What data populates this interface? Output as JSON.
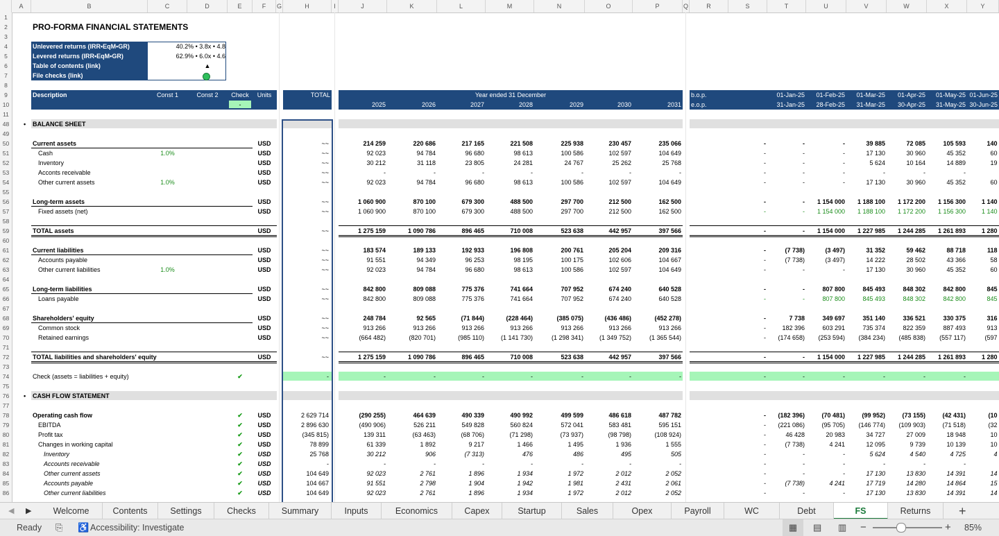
{
  "columns": [
    "A",
    "B",
    "C",
    "D",
    "E",
    "F",
    "G",
    "H",
    "I",
    "J",
    "K",
    "L",
    "M",
    "N",
    "O",
    "P",
    "Q",
    "R",
    "S",
    "T",
    "U",
    "V",
    "W",
    "X",
    "Y"
  ],
  "rows": [
    "1",
    "2",
    "3",
    "4",
    "5",
    "6",
    "7",
    "8",
    "9",
    "10",
    "11",
    "48",
    "49",
    "50",
    "51",
    "52",
    "53",
    "54",
    "55",
    "56",
    "57",
    "58",
    "59",
    "60",
    "61",
    "62",
    "63",
    "64",
    "65",
    "66",
    "67",
    "68",
    "69",
    "70",
    "71",
    "72",
    "73",
    "74",
    "75",
    "76",
    "77",
    "78",
    "79",
    "80",
    "81",
    "82",
    "83",
    "84",
    "85",
    "86"
  ],
  "title": "PRO-FORMA FINANCIAL STATEMENTS",
  "summary": {
    "unlev_label": "Unlevered returns (IRR•EqM•GR)",
    "unlev_value": "40.2% • 3.8x • 4.8",
    "lev_label": "Levered returns (IRR•EqM•GR)",
    "lev_value": "62.9% • 6.0x • 4.6",
    "toc_label": "Table of contents (link)",
    "toc_icon": "▲",
    "checks_label": "File checks (link)"
  },
  "header": {
    "description": "Description",
    "const1": "Const 1",
    "const2": "Const 2",
    "check": "Check",
    "check_value": "-",
    "units": "Units",
    "total": "TOTAL",
    "year_ended": "Year ended 31 December",
    "years": [
      "2025",
      "2026",
      "2027",
      "2028",
      "2029",
      "2030",
      "2031"
    ],
    "bop": "b.o.p.",
    "eop": "e.o.p.",
    "month_starts": [
      "01-Jan-25",
      "01-Feb-25",
      "01-Mar-25",
      "01-Apr-25",
      "01-May-25",
      "01-Jun-25",
      "01-Jul-2"
    ],
    "month_ends": [
      "31-Jan-25",
      "28-Feb-25",
      "31-Mar-25",
      "30-Apr-25",
      "31-May-25",
      "30-Jun-25",
      "31-Jul-2"
    ]
  },
  "sections": {
    "balance": "BALANCE SHEET",
    "cashflow": "CASH FLOW STATEMENT",
    "bullet": "•"
  },
  "lines": [
    {
      "row": 50,
      "label": "Current assets",
      "bold": true,
      "units": "USD",
      "total": "~~",
      "years": [
        "214 259",
        "220 686",
        "217 165",
        "221 508",
        "225 938",
        "230 457",
        "235 066"
      ],
      "months": [
        "-",
        "-",
        "-",
        "39 885",
        "72 085",
        "105 593",
        "140 01"
      ]
    },
    {
      "row": 51,
      "label": "Cash",
      "indent": 1,
      "const1": "1.0%",
      "units": "USD",
      "total": "~~",
      "years": [
        "92 023",
        "94 784",
        "96 680",
        "98 613",
        "100 586",
        "102 597",
        "104 649"
      ],
      "months": [
        "-",
        "-",
        "-",
        "17 130",
        "30 960",
        "45 352",
        "60 13"
      ]
    },
    {
      "row": 52,
      "label": "Inventory",
      "indent": 1,
      "units": "USD",
      "total": "~~",
      "years": [
        "30 212",
        "31 118",
        "23 805",
        "24 281",
        "24 767",
        "25 262",
        "25 768"
      ],
      "months": [
        "-",
        "-",
        "-",
        "5 624",
        "10 164",
        "14 889",
        "19 74"
      ]
    },
    {
      "row": 53,
      "label": "Acconts receivable",
      "indent": 1,
      "units": "USD",
      "total": "~~",
      "years": [
        "-",
        "-",
        "-",
        "-",
        "-",
        "-",
        "-"
      ],
      "months": [
        "-",
        "-",
        "-",
        "-",
        "-",
        "-",
        "-"
      ]
    },
    {
      "row": 54,
      "label": "Other current assets",
      "indent": 1,
      "const1": "1.0%",
      "units": "USD",
      "total": "~~",
      "years": [
        "92 023",
        "94 784",
        "96 680",
        "98 613",
        "100 586",
        "102 597",
        "104 649"
      ],
      "months": [
        "-",
        "-",
        "-",
        "17 130",
        "30 960",
        "45 352",
        "60 13"
      ]
    },
    {
      "row": 56,
      "label": "Long-term assets",
      "bold": true,
      "units": "USD",
      "total": "~~",
      "years": [
        "1 060 900",
        "870 100",
        "679 300",
        "488 500",
        "297 700",
        "212 500",
        "162 500"
      ],
      "months": [
        "-",
        "-",
        "1 154 000",
        "1 188 100",
        "1 172 200",
        "1 156 300",
        "1 140 40"
      ]
    },
    {
      "row": 57,
      "label": "Fixed assets (net)",
      "indent": 1,
      "units": "USD",
      "total": "~~",
      "years": [
        "1 060 900",
        "870 100",
        "679 300",
        "488 500",
        "297 700",
        "212 500",
        "162 500"
      ],
      "months": [
        "-",
        "-",
        "1 154 000",
        "1 188 100",
        "1 172 200",
        "1 156 300",
        "1 140 40"
      ],
      "green_months": true
    },
    {
      "row": 59,
      "label": "TOTAL assets",
      "bold": true,
      "units": "USD",
      "total": "~~",
      "years": [
        "1 275 159",
        "1 090 786",
        "896 465",
        "710 008",
        "523 638",
        "442 957",
        "397 566"
      ],
      "months": [
        "-",
        "-",
        "1 154 000",
        "1 227 985",
        "1 244 285",
        "1 261 893",
        "1 280 41"
      ],
      "dbl": true
    },
    {
      "row": 61,
      "label": "Current liabilities",
      "bold": true,
      "units": "USD",
      "total": "~~",
      "years": [
        "183 574",
        "189 133",
        "192 933",
        "196 808",
        "200 761",
        "205 204",
        "209 316"
      ],
      "months": [
        "-",
        "(7 738)",
        "(3 497)",
        "31 352",
        "59 462",
        "88 718",
        "118 77"
      ]
    },
    {
      "row": 62,
      "label": "Accounts payable",
      "indent": 1,
      "units": "USD",
      "total": "~~",
      "years": [
        "91 551",
        "94 349",
        "96 253",
        "98 195",
        "100 175",
        "102 606",
        "104 667"
      ],
      "months": [
        "-",
        "(7 738)",
        "(3 497)",
        "14 222",
        "28 502",
        "43 366",
        "58 63"
      ]
    },
    {
      "row": 63,
      "label": "Other current liabilities",
      "indent": 1,
      "const1": "1.0%",
      "units": "USD",
      "total": "~~",
      "years": [
        "92 023",
        "94 784",
        "96 680",
        "98 613",
        "100 586",
        "102 597",
        "104 649"
      ],
      "months": [
        "-",
        "-",
        "-",
        "17 130",
        "30 960",
        "45 352",
        "60 13"
      ]
    },
    {
      "row": 65,
      "label": "Long-term liabilities",
      "bold": true,
      "units": "USD",
      "total": "~~",
      "years": [
        "842 800",
        "809 088",
        "775 376",
        "741 664",
        "707 952",
        "674 240",
        "640 528"
      ],
      "months": [
        "-",
        "-",
        "807 800",
        "845 493",
        "848 302",
        "842 800",
        "845 60"
      ]
    },
    {
      "row": 66,
      "label": "Loans payable",
      "indent": 1,
      "units": "USD",
      "total": "~~",
      "years": [
        "842 800",
        "809 088",
        "775 376",
        "741 664",
        "707 952",
        "674 240",
        "640 528"
      ],
      "months": [
        "-",
        "-",
        "807 800",
        "845 493",
        "848 302",
        "842 800",
        "845 60"
      ],
      "green_months": true
    },
    {
      "row": 68,
      "label": "Shareholders' equity",
      "bold": true,
      "units": "USD",
      "total": "~~",
      "years": [
        "248 784",
        "92 565",
        "(71 844)",
        "(228 464)",
        "(385 075)",
        "(436 486)",
        "(452 278)"
      ],
      "months": [
        "-",
        "7 738",
        "349 697",
        "351 140",
        "336 521",
        "330 375",
        "316 03"
      ]
    },
    {
      "row": 69,
      "label": "Common stock",
      "indent": 1,
      "units": "USD",
      "total": "~~",
      "years": [
        "913 266",
        "913 266",
        "913 266",
        "913 266",
        "913 266",
        "913 266",
        "913 266"
      ],
      "months": [
        "-",
        "182 396",
        "603 291",
        "735 374",
        "822 359",
        "887 493",
        "913 26"
      ]
    },
    {
      "row": 70,
      "label": "Retained earnings",
      "indent": 1,
      "units": "USD",
      "total": "~~",
      "years": [
        "(664 482)",
        "(820 701)",
        "(985 110)",
        "(1 141 730)",
        "(1 298 341)",
        "(1 349 752)",
        "(1 365 544)"
      ],
      "months": [
        "-",
        "(174 658)",
        "(253 594)",
        "(384 234)",
        "(485 838)",
        "(557 117)",
        "(597 23"
      ]
    },
    {
      "row": 72,
      "label": "TOTAL liabilities and shareholders' equity",
      "bold": true,
      "units": "USD",
      "total": "~~",
      "years": [
        "1 275 159",
        "1 090 786",
        "896 465",
        "710 008",
        "523 638",
        "442 957",
        "397 566"
      ],
      "months": [
        "-",
        "-",
        "1 154 000",
        "1 227 985",
        "1 244 285",
        "1 261 893",
        "1 280 41"
      ],
      "dbl": true
    },
    {
      "row": 74,
      "label": "Check (assets = liabilities + equity)",
      "check": true,
      "total": "-",
      "years": [
        "-",
        "-",
        "-",
        "-",
        "-",
        "-",
        "-"
      ],
      "months": [
        "-",
        "-",
        "-",
        "-",
        "-",
        "-",
        "-"
      ],
      "green_band": true
    },
    {
      "row": 78,
      "label": "Operating cash flow",
      "bold": true,
      "check": true,
      "units": "USD",
      "total": "2 629 714",
      "years": [
        "(290 255)",
        "464 639",
        "490 339",
        "490 992",
        "499 599",
        "486 618",
        "487 782"
      ],
      "months": [
        "-",
        "(182 396)",
        "(70 481)",
        "(99 952)",
        "(73 155)",
        "(42 431)",
        "(10 98"
      ]
    },
    {
      "row": 79,
      "label": "EBITDA",
      "indent": 1,
      "check": true,
      "units": "USD",
      "total": "2 896 630",
      "years": [
        "(490 906)",
        "526 211",
        "549 828",
        "560 824",
        "572 041",
        "583 481",
        "595 151"
      ],
      "months": [
        "-",
        "(221 086)",
        "(95 705)",
        "(146 774)",
        "(109 903)",
        "(71 518)",
        "(32 06"
      ]
    },
    {
      "row": 80,
      "label": "Profit tax",
      "indent": 1,
      "check": true,
      "units": "USD",
      "total": "(345 815)",
      "years": [
        "139 311",
        "(63 463)",
        "(68 706)",
        "(71 298)",
        "(73 937)",
        "(98 798)",
        "(108 924)"
      ],
      "months": [
        "-",
        "46 428",
        "20 983",
        "34 727",
        "27 009",
        "18 948",
        "10 66"
      ]
    },
    {
      "row": 81,
      "label": "Changes in working capital",
      "indent": 1,
      "check": true,
      "units": "USD",
      "total": "78 899",
      "years": [
        "61 339",
        "1 892",
        "9 217",
        "1 466",
        "1 495",
        "1 936",
        "1 555"
      ],
      "months": [
        "-",
        "(7 738)",
        "4 241",
        "12 095",
        "9 739",
        "10 139",
        "10 41"
      ]
    },
    {
      "row": 82,
      "label": "Inventory",
      "indent": 2,
      "italic": true,
      "check": true,
      "units": "USD",
      "total": "25 768",
      "years": [
        "30 212",
        "906",
        "(7 313)",
        "476",
        "486",
        "495",
        "505"
      ],
      "months": [
        "-",
        "-",
        "-",
        "5 624",
        "4 540",
        "4 725",
        "4 85"
      ]
    },
    {
      "row": 83,
      "label": "Accounts receivable",
      "indent": 2,
      "italic": true,
      "check": true,
      "units": "USD",
      "total": "-",
      "years": [
        "-",
        "-",
        "-",
        "-",
        "-",
        "-",
        "-"
      ],
      "months": [
        "-",
        "-",
        "-",
        "-",
        "-",
        "-",
        "-"
      ]
    },
    {
      "row": 84,
      "label": "Other current assets",
      "indent": 2,
      "italic": true,
      "check": true,
      "units": "USD",
      "total": "104 649",
      "years": [
        "92 023",
        "2 761",
        "1 896",
        "1 934",
        "1 972",
        "2 012",
        "2 052"
      ],
      "months": [
        "-",
        "-",
        "-",
        "17 130",
        "13 830",
        "14 391",
        "14 78"
      ]
    },
    {
      "row": 85,
      "label": "Accounts payable",
      "indent": 2,
      "italic": true,
      "check": true,
      "units": "USD",
      "total": "104 667",
      "years": [
        "91 551",
        "2 798",
        "1 904",
        "1 942",
        "1 981",
        "2 431",
        "2 061"
      ],
      "months": [
        "-",
        "(7 738)",
        "4 241",
        "17 719",
        "14 280",
        "14 864",
        "15 27"
      ]
    },
    {
      "row": 86,
      "label": "Other current liabilities",
      "indent": 2,
      "italic": true,
      "check": true,
      "units": "USD",
      "total": "104 649",
      "years": [
        "92 023",
        "2 761",
        "1 896",
        "1 934",
        "1 972",
        "2 012",
        "2 052"
      ],
      "months": [
        "-",
        "-",
        "-",
        "17 130",
        "13 830",
        "14 391",
        "14 78"
      ]
    }
  ],
  "check_mark": "✔",
  "tabs": [
    "Welcome",
    "Contents",
    "Settings",
    "Checks",
    "Summary",
    "Inputs",
    "Economics",
    "Capex",
    "Startup",
    "Sales",
    "Opex",
    "Payroll",
    "WC",
    "Debt",
    "FS",
    "Returns"
  ],
  "active_tab": "FS",
  "status": {
    "ready": "Ready",
    "accessibility": "Accessibility: Investigate",
    "zoom": "85%",
    "add": "+"
  }
}
